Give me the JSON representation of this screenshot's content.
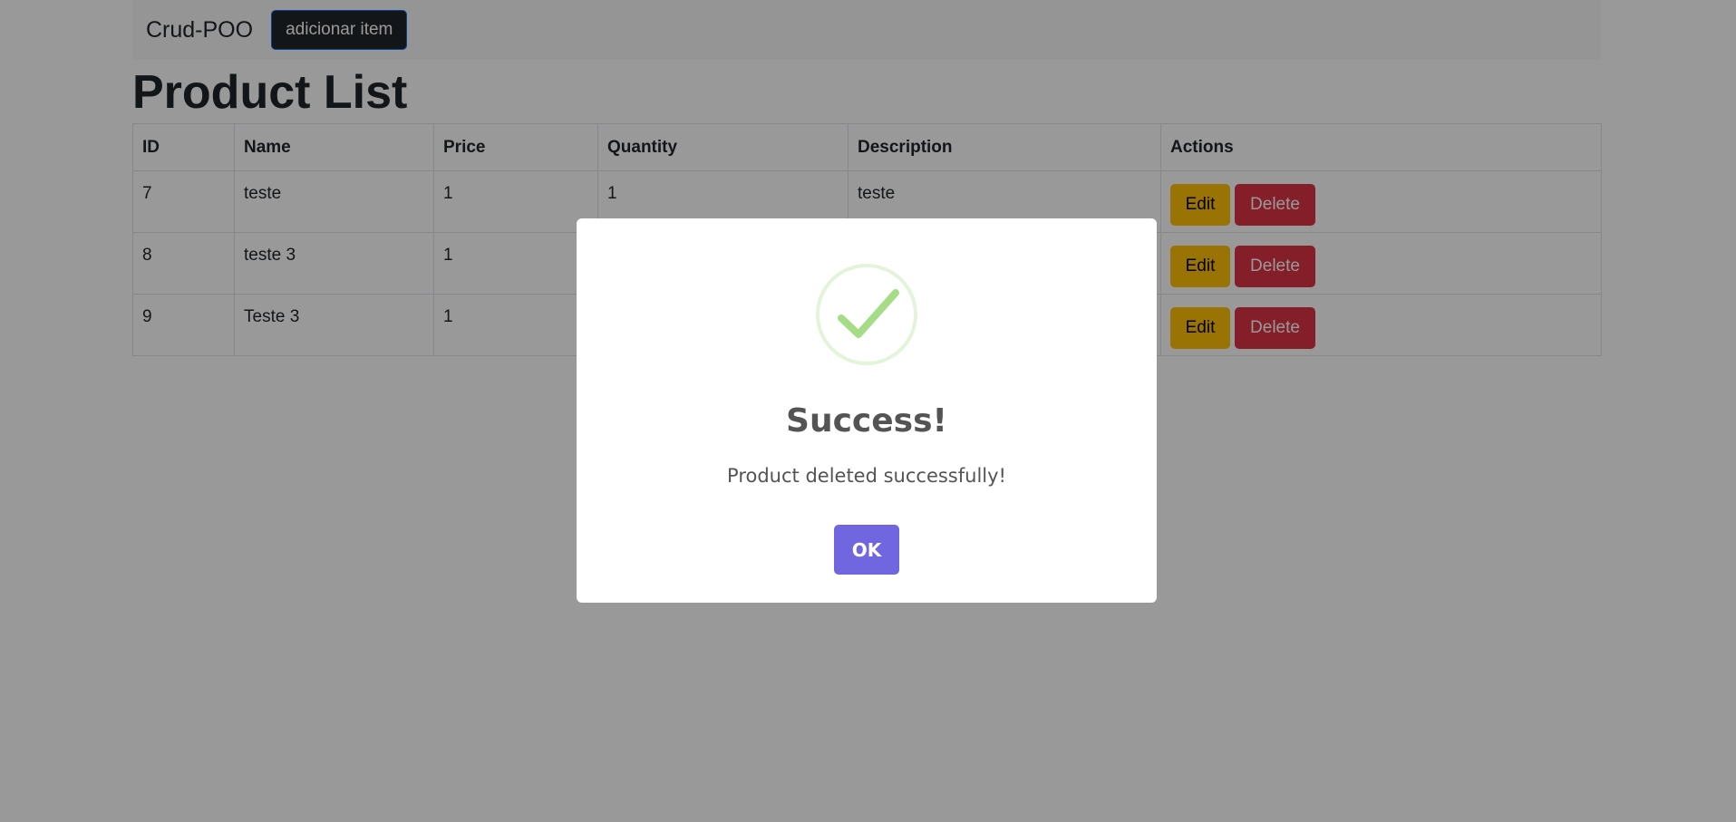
{
  "navbar": {
    "brand": "Crud-POO",
    "add_button": "adicionar item"
  },
  "page": {
    "title": "Product List"
  },
  "table": {
    "headers": [
      "ID",
      "Name",
      "Price",
      "Quantity",
      "Description",
      "Actions"
    ],
    "rows": [
      {
        "id": "7",
        "name": "teste",
        "price": "1",
        "quantity": "1",
        "description": "teste"
      },
      {
        "id": "8",
        "name": "teste 3",
        "price": "1",
        "quantity": "",
        "description": ""
      },
      {
        "id": "9",
        "name": "Teste 3",
        "price": "1",
        "quantity": "",
        "description": ""
      }
    ],
    "edit_label": "Edit",
    "delete_label": "Delete"
  },
  "modal": {
    "icon": "check-icon",
    "title": "Success!",
    "message": "Product deleted successfully!",
    "ok_label": "OK"
  },
  "colors": {
    "edit": "#ffc107",
    "delete": "#dc3545",
    "confirm": "#7066e0",
    "success": "#a5dc86"
  }
}
